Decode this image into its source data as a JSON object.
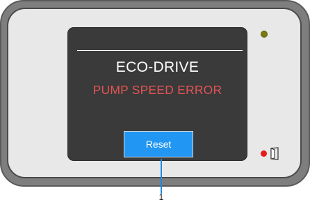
{
  "device": {
    "screen": {
      "title": "ECO-DRIVE",
      "error_message": "PUMP SPEED ERROR",
      "reset_label": "Reset"
    },
    "indicators": {
      "status_led": "olive-led",
      "alarm_led": "red-led",
      "door_icon": "door-icon"
    }
  },
  "callout": {
    "number": "1"
  },
  "colors": {
    "screen_bg": "#3a3a3a",
    "error_text": "#e05454",
    "button_bg": "#2196f3",
    "status_led": "#7a7a10",
    "alarm_led": "#e81a1a",
    "callout_line": "#1e88e5"
  }
}
